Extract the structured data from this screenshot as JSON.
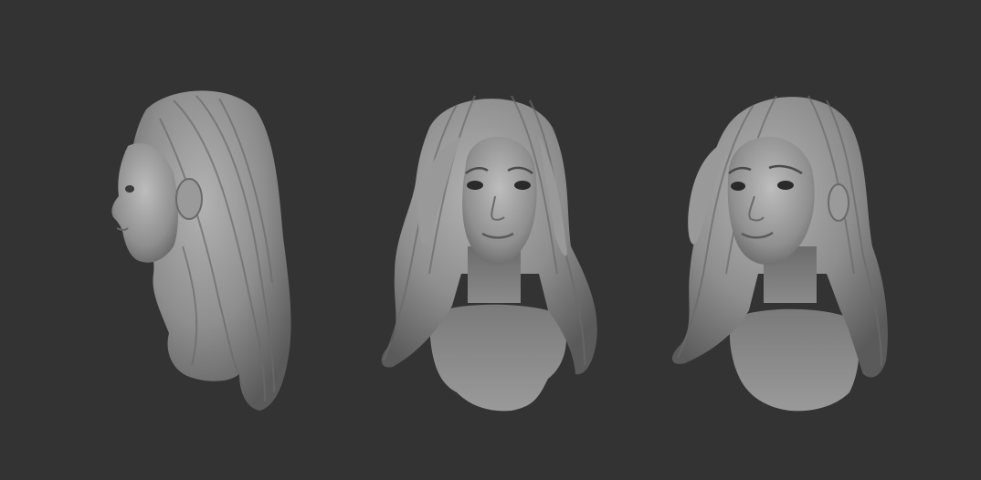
{
  "scene": {
    "background_color": "#333333",
    "clay_color": "#8c8c8c",
    "views": [
      {
        "name": "side-profile-left"
      },
      {
        "name": "front"
      },
      {
        "name": "three-quarter-right"
      }
    ]
  }
}
